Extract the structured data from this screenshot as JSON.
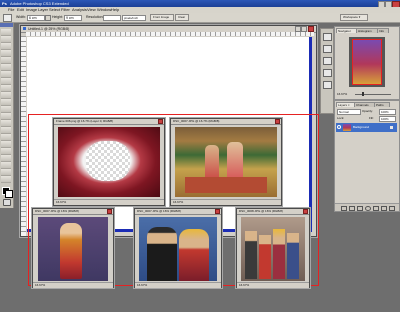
{
  "app": {
    "window_title": "Adobe Photoshop CS3 Extended",
    "menu": [
      "File",
      "Edit",
      "Image",
      "Layer",
      "Select",
      "Filter",
      "Analysis",
      "View",
      "Window",
      "Help"
    ],
    "workspace_label": "Workspace ▾",
    "options": {
      "width_label": "Width:",
      "width_value": "6 cm",
      "height_label": "Height:",
      "height_value": "9 cm",
      "resolution_label": "Resolution:",
      "resolution_value": "",
      "resolution_unit": "pixels/inch",
      "front_image_btn": "Front Image",
      "clear_btn": "Clear"
    }
  },
  "documents": {
    "untitled": {
      "title": "Untitled-1 @ 25% (RGB/8)"
    },
    "frame": {
      "title": "Frame 006.png @ 16.7% (Layer 0, RGB/8)",
      "zoom": "16.67%"
    },
    "dsc_a": {
      "title": "DSC_0007.JPG @ 16.7% (RGB/8)",
      "zoom": "16.67%"
    },
    "dsc_b": {
      "title": "DSC_0007.JPG @ 16% (RGB/8)",
      "zoom": "16.67%"
    },
    "dsc_c": {
      "title": "DSC_0007.JPG @ 16% (RGB/8)",
      "zoom": "16.67%"
    },
    "dsc_d": {
      "title": "DSC_0008.JPG @ 16% (RGB/8)",
      "zoom": "16.67%"
    }
  },
  "panels": {
    "navigator": {
      "tabs": [
        "Navigator",
        "Histogram",
        "Info"
      ],
      "zoom": "16.67%"
    },
    "layers": {
      "tabs": [
        "Layers ×",
        "Channels",
        "Paths"
      ],
      "blend_mode": "Normal",
      "opacity_label": "Opacity:",
      "opacity_value": "100%",
      "lock_label": "Lock:",
      "fill_label": "Fill:",
      "fill_value": "100%",
      "layer_name": "Background"
    }
  },
  "colors": {
    "titlebar": "#1f47a5",
    "highlight_rect": "#e52222",
    "canvas": "#ffffff",
    "workspace": "#6e6e6e",
    "doc_border_blue": "#1b2cb5"
  }
}
